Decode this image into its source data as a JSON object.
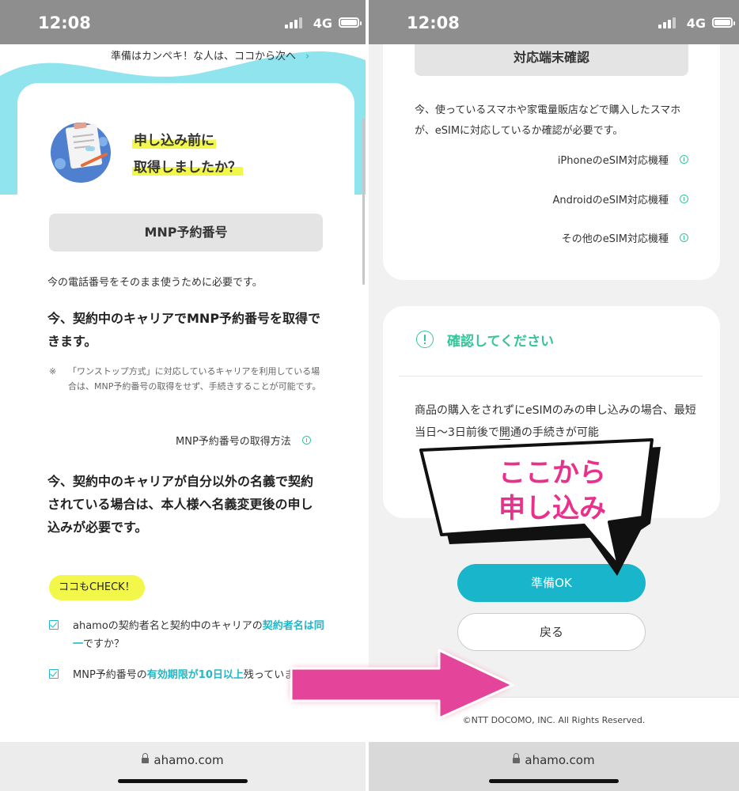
{
  "left": {
    "status": {
      "time": "12:08",
      "network": "4G"
    },
    "next_link": "準備はカンペキ！な人は、ココから次へ",
    "next_chevron": "›",
    "heading_line1": "申し込み前に",
    "heading_line2": "取得しましたか？",
    "mnp_button": "MNP予約番号",
    "desc": "今の電話番号をそのまま使うために必要です。",
    "bold1": "今、契約中のキャリアでMNP予約番号を取得できます。",
    "note_mark": "※",
    "note": "「ワンストップ方式」に対応しているキャリアを利用している場合は、MNP予約番号の取得をせず、手続きすることが可能です。",
    "mnp_link": "MNP予約番号の取得方法",
    "bold2": "今、契約中のキャリアが自分以外の名義で契約されている場合は、本人様へ名義変更後の申し込みが必要です。",
    "check_pill": "ココもCHECK！",
    "check1_pre": "ahamoの契約者名と契約中のキャリアの",
    "check1_em": "契約者名は同一",
    "check1_post": "ですか？",
    "check2_pre": "MNP予約番号の",
    "check2_em": "有効期限が10日以上",
    "check2_post": "残っていますか？",
    "url": "ahamo.com"
  },
  "right": {
    "status": {
      "time": "12:08",
      "network": "4G"
    },
    "device_button": "対応端末確認",
    "device_desc": "今、使っているスマホや家電量販店などで購入したスマホが、eSIMに対応しているか確認が必要です。",
    "links": [
      "iPhoneのeSIM対応機種",
      "AndroidのeSIM対応機種",
      "その他のeSIM対応機種"
    ],
    "confirm_title": "確認してください",
    "confirm_text_pre": "商品の購入をされずにeSIMのみの申し込みの場合、最短当日〜3日前後で",
    "confirm_text_ul": "開",
    "confirm_text_post": "通の手続きが可能",
    "ok_button": "準備OK",
    "back_button": "戻る",
    "copyright": "©NTT DOCOMO, INC. All Rights Reserved.",
    "url": "ahamo.com"
  },
  "callout": {
    "line1": "ここから",
    "line2": "申し込み"
  },
  "colors": {
    "teal": "#19b5cb",
    "green": "#35c59b",
    "yellow": "#f3f74a",
    "pink": "#e8318b",
    "wave": "#8fe4ee"
  }
}
